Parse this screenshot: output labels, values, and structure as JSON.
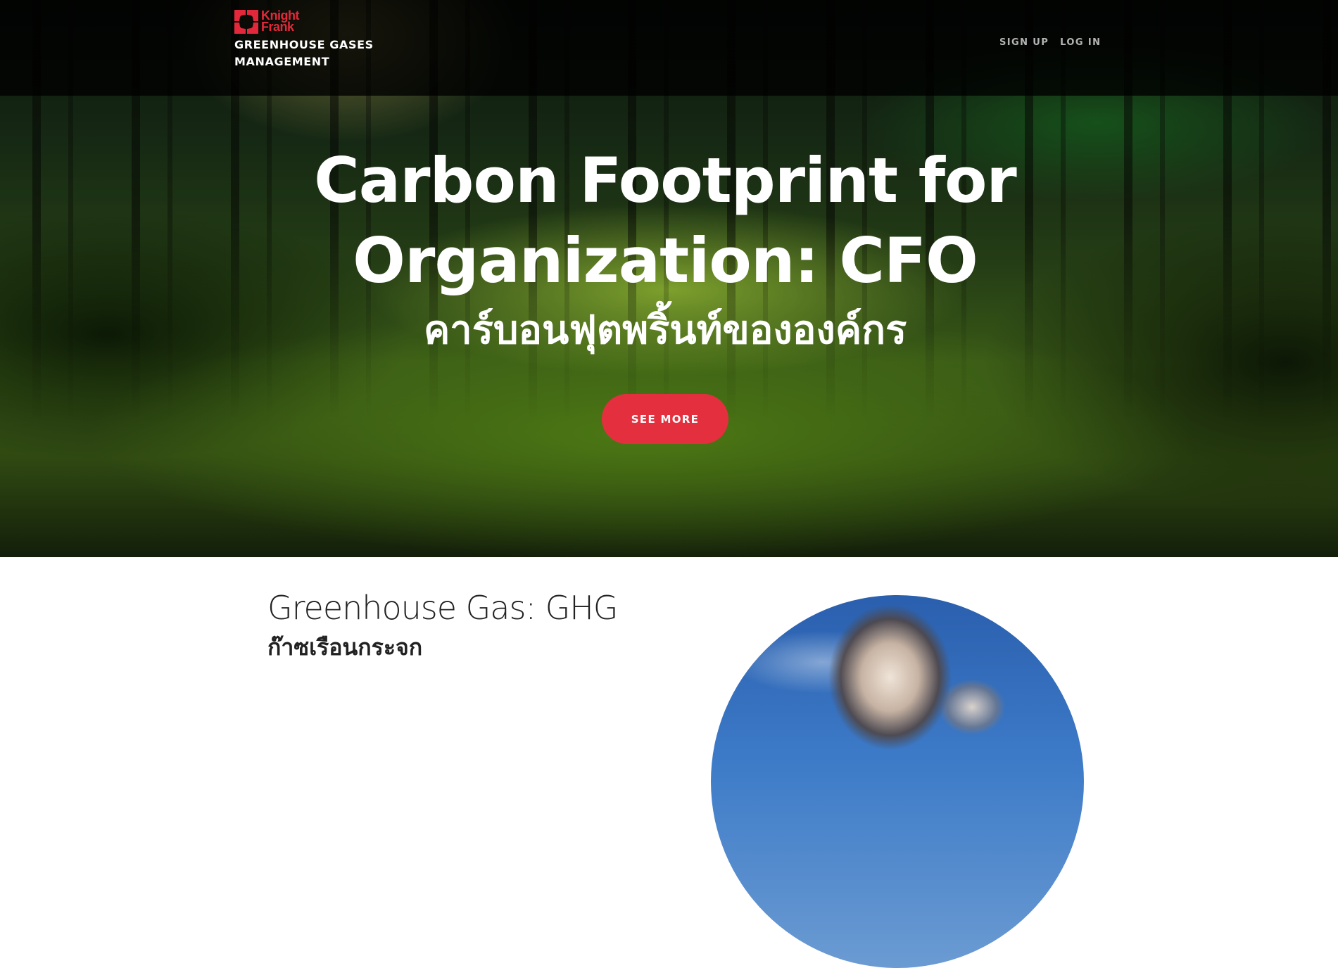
{
  "navbar": {
    "logo": {
      "line1": "Knight",
      "line2": "Frank",
      "brand_color": "#e4283b"
    },
    "site_title": "GREENHOUSE GASES MANAGEMENT",
    "links": [
      {
        "label": "SIGN UP"
      },
      {
        "label": "LOG IN"
      }
    ]
  },
  "hero": {
    "title": "Carbon Footprint for Organization: CFO",
    "subtitle": "คาร์บอนฟุตพริ้นท์ขององค์กร",
    "cta_label": "SEE MORE",
    "cta_color": "#e4303e",
    "background": "forest-photo"
  },
  "section": {
    "heading": "Greenhouse Gas: GHG",
    "subheading": "ก๊าซเรือนกระจก",
    "image": "sky-clouds-photo"
  }
}
